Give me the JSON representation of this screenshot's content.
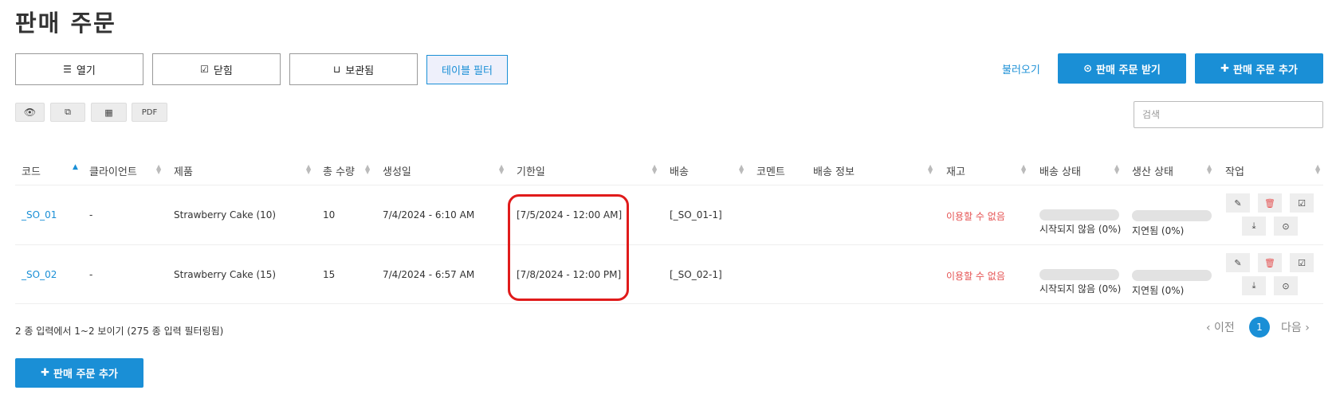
{
  "page": {
    "title": "판매 주문"
  },
  "tabs": [
    {
      "label": "열기",
      "icon": "list-icon"
    },
    {
      "label": "닫힘",
      "icon": "check-square-icon"
    },
    {
      "label": "보관됨",
      "icon": "inbox-icon"
    },
    {
      "label": "테이블 필터",
      "active": true
    }
  ],
  "actions": {
    "import_label": "불러오기",
    "receive_label": "판매 주문 받기",
    "add_label": "판매 주문 추가",
    "add_bottom_label": "판매 주문 추가"
  },
  "toolbar": {
    "pdf_label": "PDF"
  },
  "search": {
    "placeholder": "검색"
  },
  "table": {
    "columns": [
      "코드",
      "클라이언트",
      "제품",
      "총 수량",
      "생성일",
      "기한일",
      "배송",
      "코멘트",
      "배송 정보",
      "재고",
      "배송 상태",
      "생산 상태",
      "작업"
    ],
    "rows": [
      {
        "code": "_SO_01",
        "client": "-",
        "product": "Strawberry Cake (10)",
        "qty": "10",
        "created": "7/4/2024 - 6:10 AM",
        "due": "[7/5/2024 - 12:00 AM]",
        "shipping": "[_SO_01-1]",
        "stock": "이용할 수 없음",
        "ship_status": "시작되지 않음 (0%)",
        "prod_status": "지연됨 (0%)"
      },
      {
        "code": "_SO_02",
        "client": "-",
        "product": "Strawberry Cake (15)",
        "qty": "15",
        "created": "7/4/2024 - 6:57 AM",
        "due": "[7/8/2024 - 12:00 PM]",
        "shipping": "[_SO_02-1]",
        "stock": "이용할 수 없음",
        "ship_status": "시작되지 않음 (0%)",
        "prod_status": "지연됨 (0%)"
      }
    ]
  },
  "footer": {
    "summary": "2 종 입력에서 1~2 보이기 (275 종 입력 필터링됨)",
    "prev": "‹ 이전",
    "next": "다음 ›",
    "current_page": "1"
  },
  "colors": {
    "accent": "#1a8fd6",
    "danger": "#e55353",
    "highlight": "#e01b1b"
  }
}
